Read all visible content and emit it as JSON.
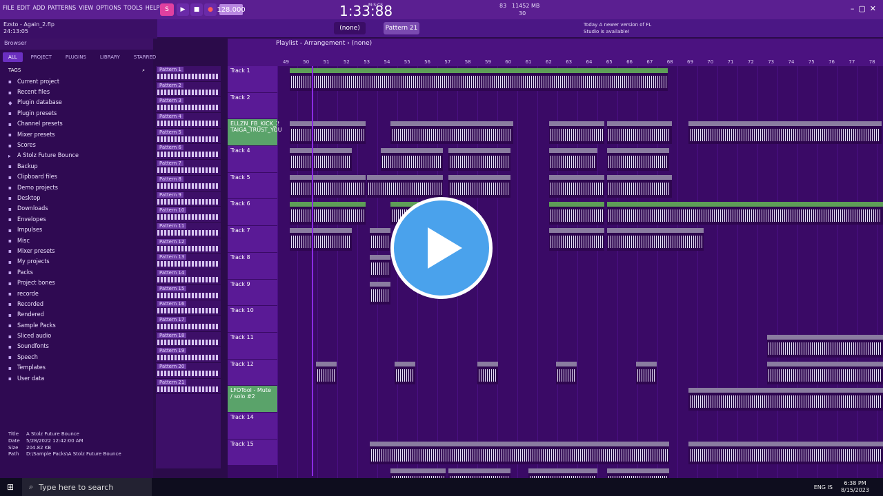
{
  "menu": [
    "FILE",
    "EDIT",
    "ADD",
    "PATTERNS",
    "VIEW",
    "OPTIONS",
    "TOOLS",
    "HELP"
  ],
  "transport": {
    "tempo": "128.000",
    "time": "1:33:88",
    "time_label": "M:S:CS",
    "mem": "11452 MB",
    "cpu": "83",
    "poly": "30"
  },
  "hint": {
    "file": "Ezsto - Again_2.flp",
    "time": "24:13:05",
    "track": "Track 1"
  },
  "toolbar": {
    "none1": "(none)",
    "pattern": "Pattern 21",
    "news": "Today  A newer version of FL Studio is available!"
  },
  "browser": {
    "title": "Browser",
    "tabs": [
      "ALL",
      "PROJECT",
      "PLUGINS",
      "LIBRARY",
      "STARRED"
    ],
    "tags": "TAGS",
    "items": [
      "Current project",
      "Recent files",
      "Plugin database",
      "Plugin presets",
      "Channel presets",
      "Mixer presets",
      "Scores",
      "A Stolz Future Bounce",
      "Backup",
      "Clipboard files",
      "Demo projects",
      "Desktop",
      "Downloads",
      "Envelopes",
      "Impulses",
      "Misc",
      "Mixer presets",
      "My projects",
      "Packs",
      "Project bones",
      "recorde",
      "Recorded",
      "Rendered",
      "Sample Packs",
      "Sliced audio",
      "Soundfonts",
      "Speech",
      "Templates",
      "User data"
    ],
    "info": {
      "title": "A Stolz Future Bounce",
      "date": "5/28/2022 12:42:00 AM",
      "size": "204.82 KB",
      "path": "D:\\Sample Packs\\A Stolz Future Bounce"
    }
  },
  "patterns": [
    "Pattern 1",
    "Pattern 2",
    "Pattern 3",
    "Pattern 4",
    "Pattern 5",
    "Pattern 6",
    "Pattern 7",
    "Pattern 8",
    "Pattern 9",
    "Pattern 10",
    "Pattern 11",
    "Pattern 12",
    "Pattern 13",
    "Pattern 14",
    "Pattern 15",
    "Pattern 16",
    "Pattern 17",
    "Pattern 18",
    "Pattern 19",
    "Pattern 20",
    "Pattern 21"
  ],
  "playlist": {
    "title": "Playlist - Arrangement  ›  (none)",
    "ruler": [
      "49",
      "50",
      "51",
      "52",
      "53",
      "54",
      "55",
      "56",
      "57",
      "58",
      "59",
      "60",
      "61",
      "62",
      "63",
      "64",
      "65",
      "66",
      "67",
      "68",
      "69",
      "70",
      "71",
      "72",
      "73",
      "74",
      "75",
      "76",
      "77",
      "78"
    ],
    "tracks": [
      "Track 1",
      "Track 2",
      "ELLZN_FB_KICK_2 TAIGA_TRUST_YOU",
      "Track 4",
      "Track 5",
      "Track 6",
      "Track 7",
      "Track 8",
      "Track 9",
      "Track 10",
      "Track 11",
      "Track 12",
      "LFOTool - Mute / solo #2",
      "Track 14",
      "Track 15"
    ]
  },
  "taskbar": {
    "search": "Type here to search",
    "lang": "ENG IS",
    "time": "6:38 PM",
    "date": "8/15/2023"
  }
}
